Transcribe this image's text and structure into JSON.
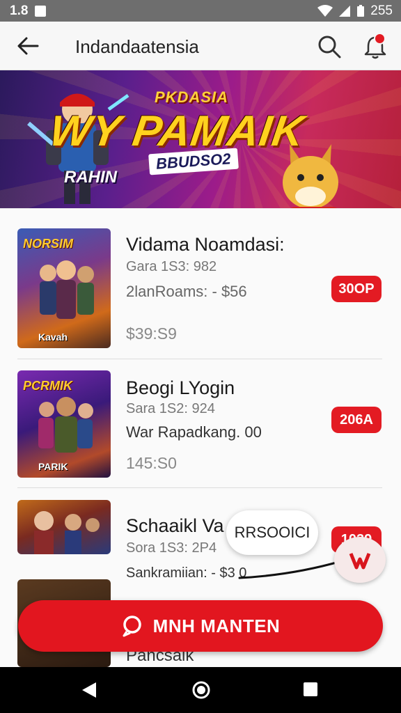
{
  "status": {
    "time_left": "1.8",
    "right_text": "255"
  },
  "app_bar": {
    "title": "Indandaatensia"
  },
  "banner": {
    "subtitle": "PKDASIA",
    "headline": "WY PAMAIK",
    "tag": "BBUDSO2",
    "corner_label": "RAHIN"
  },
  "items": [
    {
      "name": "Vidama Noamdasi:",
      "meta": "Gara 1S3: 982",
      "desc": "2lanRoams: - $56",
      "price": "$39:S9",
      "badge": "30OP",
      "thumb_title": "NORSIM",
      "thumb_foot": "Kavah"
    },
    {
      "name": "Beogi LYogin",
      "meta": "Sara 1S2: 924",
      "desc": "War Rapadkang. 00",
      "price": "145:S0",
      "badge": "206A",
      "thumb_title": "PCRMIK",
      "thumb_foot": "PARIK"
    },
    {
      "name": "Schaaikl Va",
      "meta": "Sora 1S3: 2P4",
      "desc": "Sankramiian: - $3 0",
      "price": "",
      "badge": "1039",
      "thumb_title": "",
      "thumb_foot": ""
    }
  ],
  "tooltip": {
    "text": "RRSOOICI"
  },
  "cta": {
    "label": "MNH MANTEN"
  },
  "peek": {
    "name": "Pancsaik"
  },
  "colors": {
    "accent": "#e2161f",
    "status_bar": "#6e6e6e"
  }
}
